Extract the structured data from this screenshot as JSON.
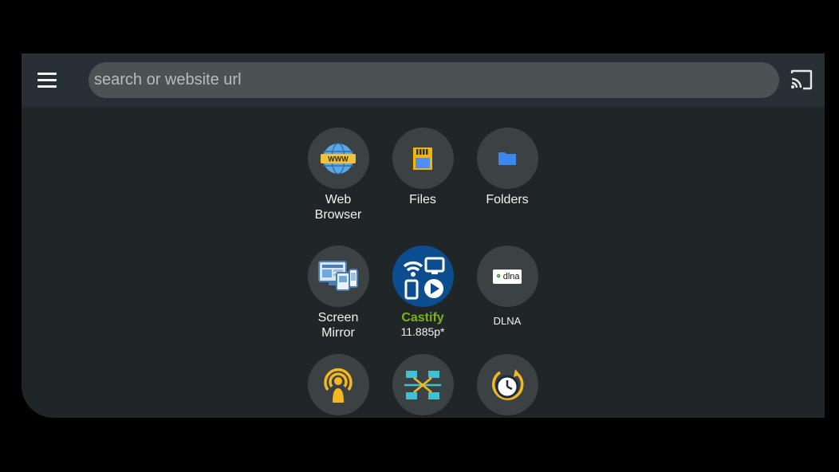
{
  "search": {
    "placeholder": "search or website url"
  },
  "tiles": [
    {
      "label_line1": "Web",
      "label_line2": "Browser",
      "icon": "globe-www-icon"
    },
    {
      "label": "Files",
      "icon": "sd-card-icon"
    },
    {
      "label": "Folders",
      "icon": "folder-icon"
    },
    {
      "label_line1": "Screen",
      "label_line2": "Mirror",
      "icon": "screen-mirror-icon"
    },
    {
      "label": "Castify",
      "sublabel": "11.885p*",
      "icon": "castify-app-icon"
    },
    {
      "label": "DLNA",
      "icon": "dlna-icon",
      "badge_text": "dlna"
    },
    {
      "icon": "podcast-icon"
    },
    {
      "icon": "network-icon"
    },
    {
      "icon": "history-clock-icon"
    }
  ],
  "colors": {
    "accent_green": "#7ab319",
    "app_bg": "#202628",
    "topbar_bg": "#263034",
    "tile_bg": "#3c4244"
  }
}
